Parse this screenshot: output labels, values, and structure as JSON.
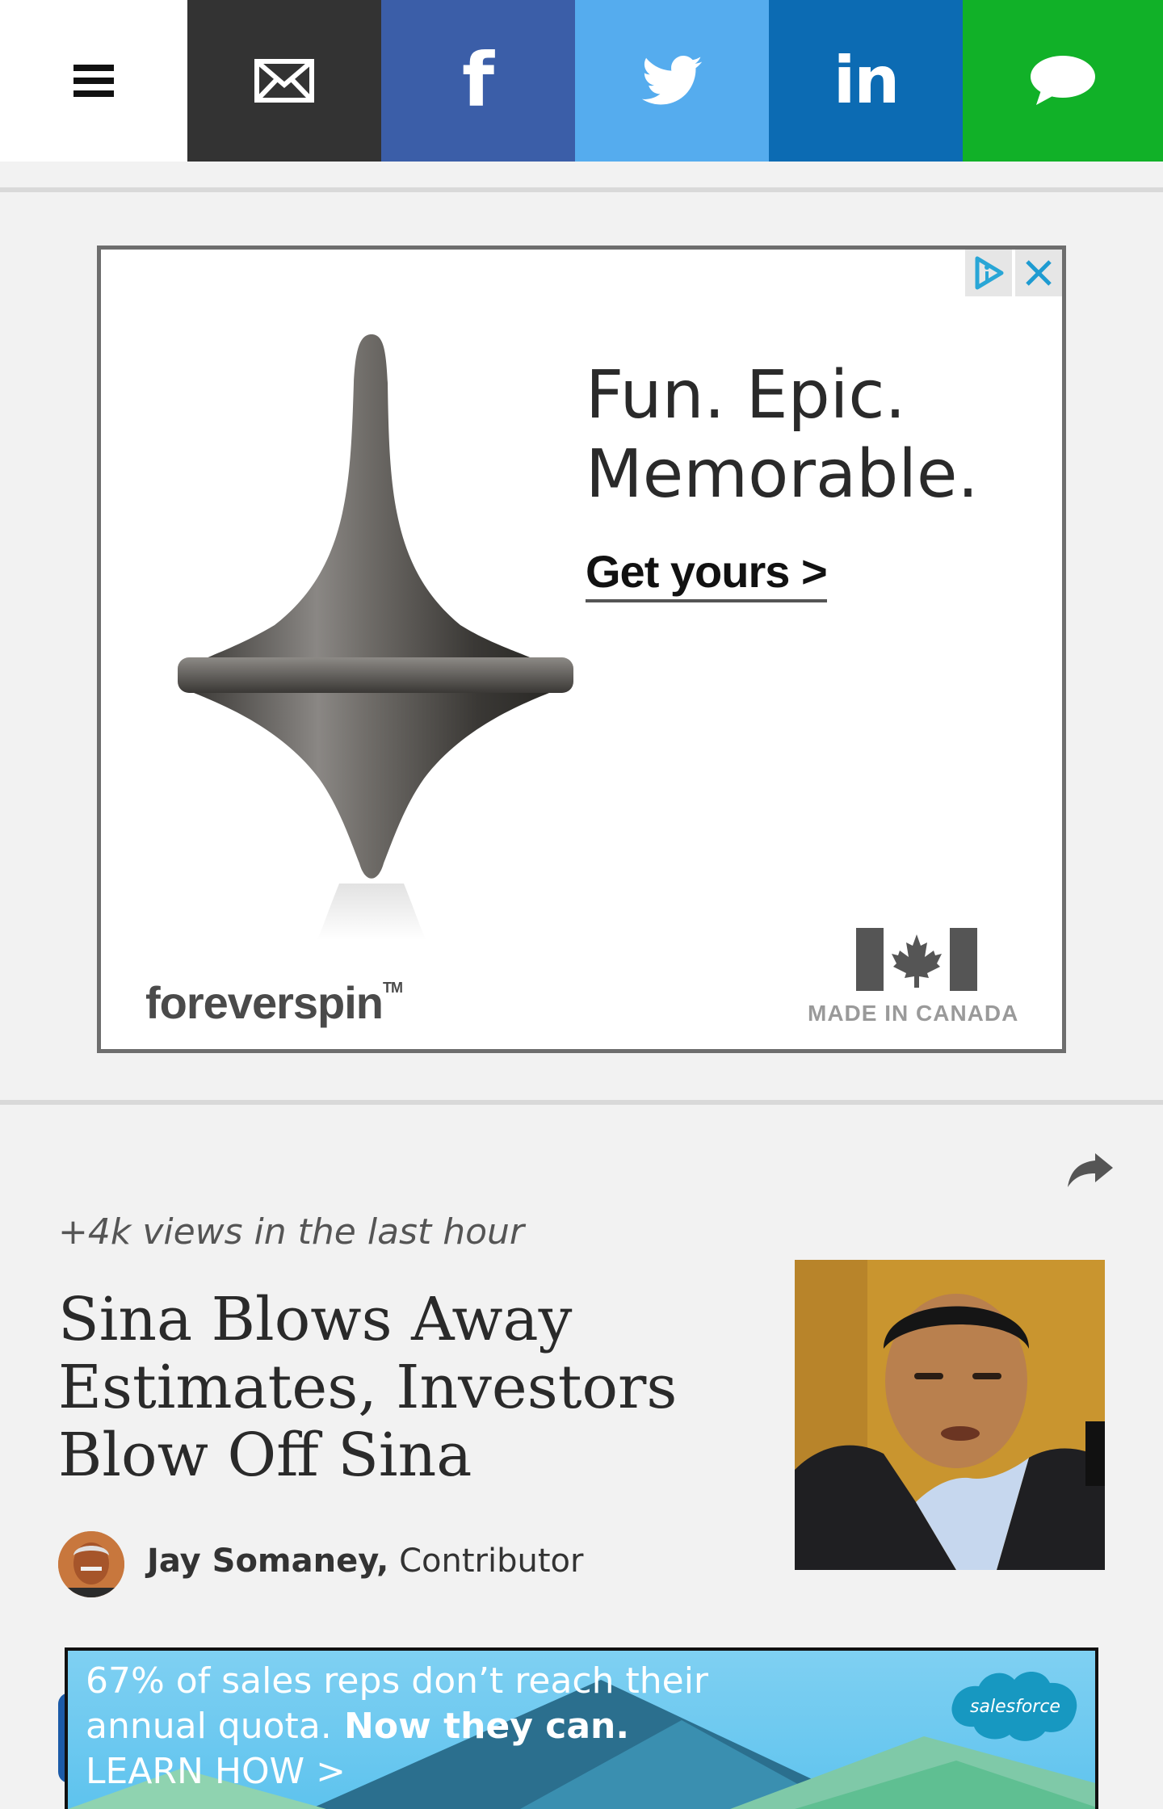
{
  "topbar": {
    "buttons": [
      {
        "name": "menu",
        "icon": "hamburger-icon",
        "bg": "#ffffff"
      },
      {
        "name": "email",
        "icon": "envelope-icon",
        "bg": "#333333"
      },
      {
        "name": "facebook",
        "icon": "facebook-icon",
        "glyph": "f",
        "bg": "#3b5ea8"
      },
      {
        "name": "twitter",
        "icon": "twitter-bird-icon",
        "bg": "#55acee"
      },
      {
        "name": "linkedin",
        "icon": "linkedin-icon",
        "glyph": "in",
        "bg": "#0c6bb3"
      },
      {
        "name": "sms",
        "icon": "speech-bubble-icon",
        "bg": "#11b128"
      }
    ]
  },
  "ad": {
    "headline_line1": "Fun. Epic.",
    "headline_line2": "Memorable.",
    "cta": "Get yours >",
    "brand": "foreverspin",
    "brand_tm": "TM",
    "made_in": "MADE IN CANADA",
    "adchoices_icon": "adchoices-icon",
    "close_icon": "close-icon"
  },
  "article": {
    "views": "+4k views in the last hour",
    "headline": "Sina Blows Away Estimates, Investors Blow Off Sina",
    "author_name": "Jay Somaney,",
    "author_role": " Contributor",
    "share_icon": "share-arrow-icon"
  },
  "bottom_ad": {
    "line1": "67% of sales reps don’t reach their",
    "line2_a": "annual quota.",
    "line2_b": " Now they can.",
    "line3": "LEARN HOW >",
    "brand": "salesforce"
  },
  "colors": {
    "page_bg": "#f2f2f2",
    "email": "#333333",
    "facebook": "#3b5ea8",
    "twitter": "#55acee",
    "linkedin": "#0c6bb3",
    "sms": "#11b128",
    "salesforce_blue": "#1798c1"
  }
}
